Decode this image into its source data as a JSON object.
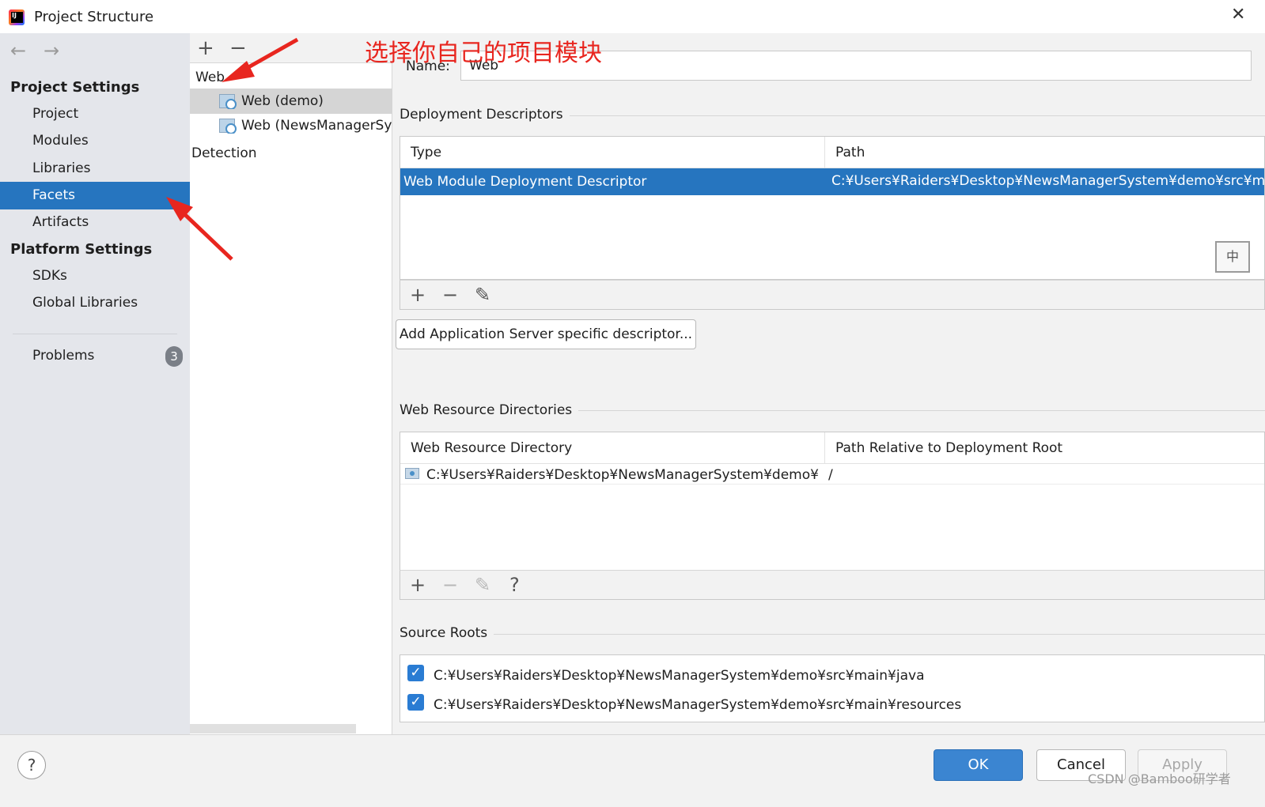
{
  "window": {
    "title": "Project Structure",
    "close": "✕"
  },
  "sidebar": {
    "back": "←",
    "forward": "→",
    "project_settings_header": "Project Settings",
    "items": [
      {
        "label": "Project"
      },
      {
        "label": "Modules"
      },
      {
        "label": "Libraries"
      },
      {
        "label": "Facets"
      },
      {
        "label": "Artifacts"
      }
    ],
    "platform_settings_header": "Platform Settings",
    "platform_items": [
      {
        "label": "SDKs"
      },
      {
        "label": "Global Libraries"
      }
    ],
    "problems_label": "Problems",
    "problems_count": "3"
  },
  "facet_tree": {
    "add": "+",
    "remove": "−",
    "group_label": "Web",
    "items": [
      {
        "label": "Web (demo)"
      },
      {
        "label": "Web (NewsManagerSys"
      }
    ],
    "detection_label": "Detection"
  },
  "facet_detail": {
    "name_label": "Name:",
    "name_value": "Web",
    "deployment": {
      "title": "Deployment Descriptors",
      "columns": [
        "Type",
        "Path"
      ],
      "rows": [
        {
          "type": "Web Module Deployment Descriptor",
          "path": "C:¥Users¥Raiders¥Desktop¥NewsManagerSystem¥demo¥src¥main¥"
        }
      ],
      "add": "+",
      "remove": "−",
      "edit": "✎",
      "add_server_button": "Add Application Server specific descriptor..."
    },
    "web_resources": {
      "title": "Web Resource Directories",
      "columns": [
        "Web Resource Directory",
        "Path Relative to Deployment Root"
      ],
      "rows": [
        {
          "directory": "C:¥Users¥Raiders¥Desktop¥NewsManagerSystem¥demo¥src¥...",
          "relative": "/"
        }
      ],
      "add": "+",
      "remove": "−",
      "edit": "✎",
      "help": "?"
    },
    "source_roots": {
      "title": "Source Roots",
      "items": [
        {
          "path": "C:¥Users¥Raiders¥Desktop¥NewsManagerSystem¥demo¥src¥main¥java",
          "checked": true
        },
        {
          "path": "C:¥Users¥Raiders¥Desktop¥NewsManagerSystem¥demo¥src¥main¥resources",
          "checked": true
        }
      ]
    },
    "ime_indicator": "中"
  },
  "footer": {
    "help": "?",
    "ok": "OK",
    "cancel": "Cancel",
    "apply": "Apply",
    "watermark": "CSDN @Bamboo研学者"
  },
  "annotation": {
    "text": "选择你自己的项目模块",
    "color": "#e8261f"
  },
  "colors": {
    "selection": "#2675bf",
    "ok_button": "#3b85d1",
    "checkbox": "#2a7cd3"
  }
}
